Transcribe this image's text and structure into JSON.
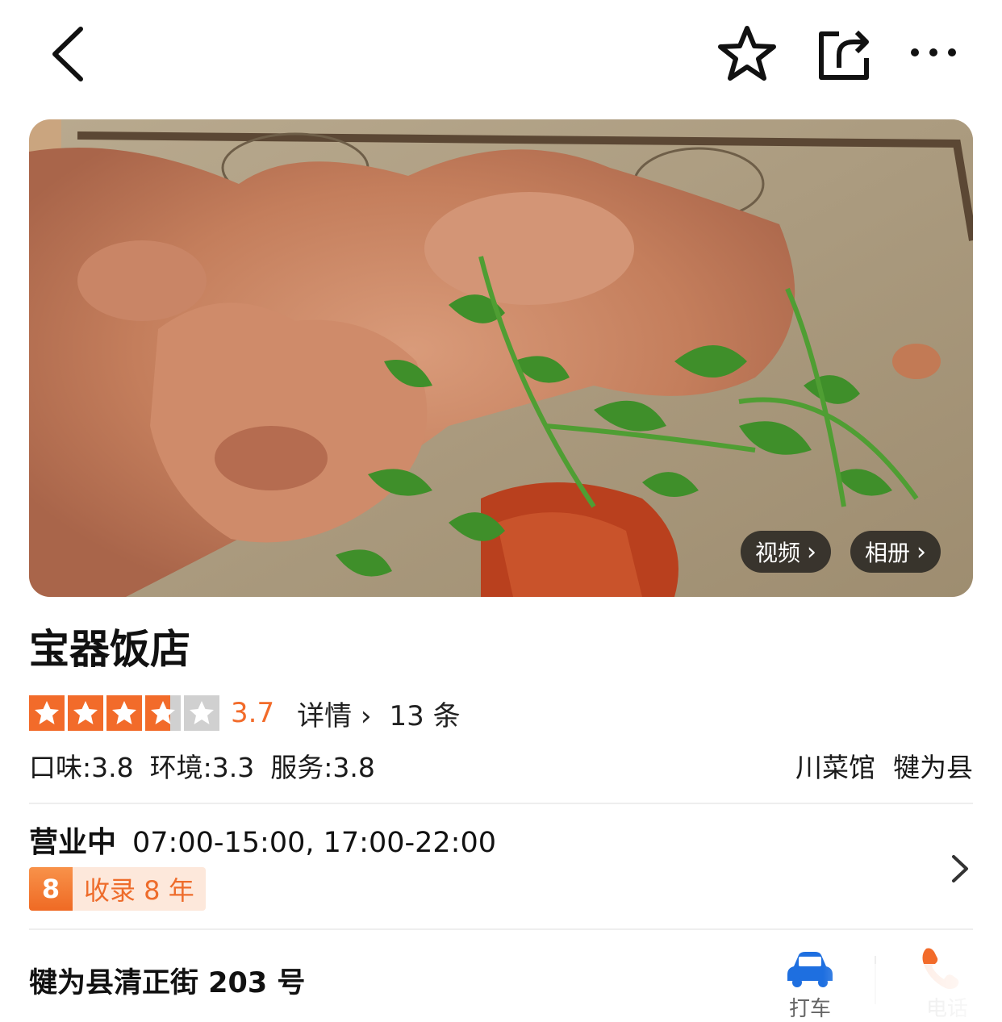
{
  "nav": {
    "back_icon": "chevron-left-icon",
    "favorite_icon": "star-outline-icon",
    "share_icon": "share-icon",
    "more_icon": "more-dots-icon"
  },
  "hero": {
    "video_label": "视频",
    "album_label": "相册",
    "image_subject": "food photo"
  },
  "shop": {
    "name": "宝器饭店",
    "rating": 3.7,
    "rating_text": "3.7",
    "details_label": "详情",
    "review_count": "13 条",
    "sub_scores": [
      "口味:3.8",
      "环境:3.3",
      "服务:3.8"
    ],
    "category": "川菜馆",
    "region": "犍为县"
  },
  "hours": {
    "status": "营业中",
    "text": "07:00-15:00, 17:00-22:00"
  },
  "badge": {
    "number": "8",
    "text": "收录 8 年"
  },
  "address": "犍为县清正街 203 号",
  "actions": {
    "taxi_label": "打车",
    "call_label": "电话"
  },
  "colors": {
    "accent": "#f26b2a",
    "star_empty": "#d0d0d0",
    "taxi_blue": "#1e6fe0"
  }
}
